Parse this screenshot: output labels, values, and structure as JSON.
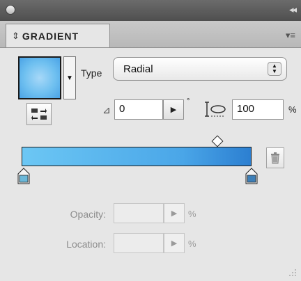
{
  "panel": {
    "tab_label": "GRADIENT",
    "tab_arrows": "⇕",
    "collapse_glyph": "◂◂",
    "menu_glyph": "▾≡"
  },
  "type": {
    "label": "Type",
    "value": "Radial",
    "stepper_up": "▲",
    "stepper_down": "▼"
  },
  "angle": {
    "value": "0",
    "unit": "°"
  },
  "aspect": {
    "value": "100",
    "unit": "%"
  },
  "opacity": {
    "label": "Opacity:",
    "value": "",
    "unit": "%"
  },
  "location": {
    "label": "Location:",
    "value": "",
    "unit": "%"
  },
  "icons": {
    "swatch_dropdown": "▼",
    "field_dropdown": "▶",
    "angle": "⊿"
  },
  "colors": {
    "gradient_start": "#6cc7f4",
    "gradient_end": "#2c7fd1",
    "stop_fill": "#6bb8d9"
  }
}
